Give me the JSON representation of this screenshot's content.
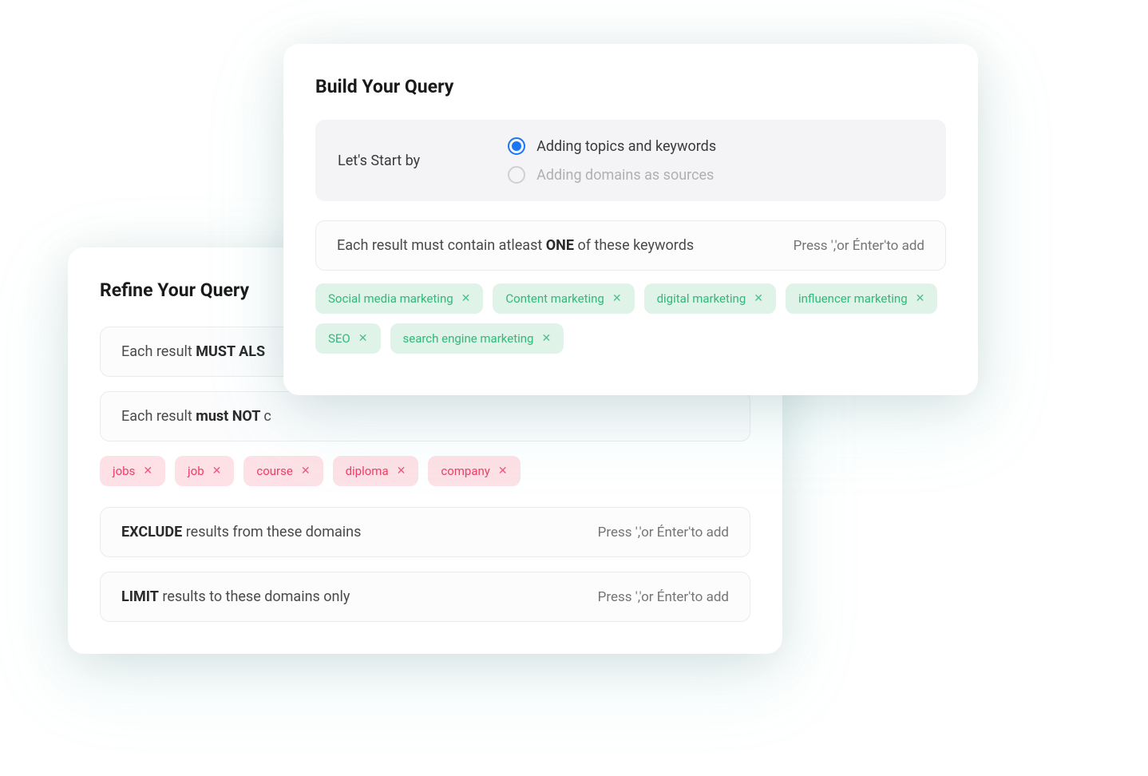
{
  "refine": {
    "title": "Refine Your Query",
    "mustAlso": {
      "prefix": "Each result ",
      "bold": "MUST ALS"
    },
    "mustNot": {
      "prefix": "Each result ",
      "bold": "must NOT ",
      "suffix": "c"
    },
    "excludeTags": [
      "jobs",
      "job",
      "course",
      "diploma",
      "company"
    ],
    "excludeDomains": {
      "bold": "EXCLUDE",
      "rest": " results from these domains",
      "placeholder": "Press ','or Énter'to add"
    },
    "limitDomains": {
      "bold": "LIMIT",
      "rest": " results to these domains only",
      "placeholder": "Press ','or Énter'to add"
    }
  },
  "build": {
    "title": "Build Your Query",
    "startLabel": "Let's Start by",
    "option1": "Adding topics and keywords",
    "option2": "Adding domains as sources",
    "keywordRow": {
      "prefix": "Each result must contain atleast ",
      "bold": "ONE",
      "suffix": " of these keywords",
      "placeholder": "Press ','or Énter'to add"
    },
    "keywordTags": [
      "Social media marketing",
      "Content marketing",
      "digital marketing",
      "influencer marketing",
      "SEO",
      "search engine marketing"
    ]
  }
}
